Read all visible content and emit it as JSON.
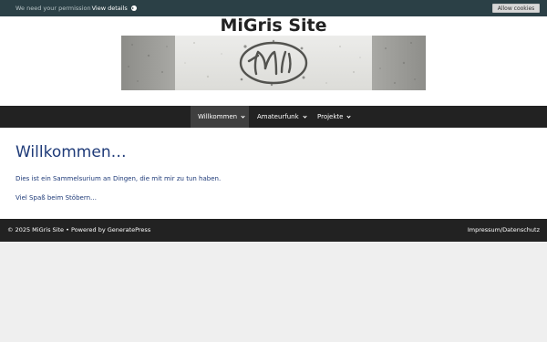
{
  "cookie_bar": {
    "message": "We need your permission",
    "link": "View details",
    "button": "Allow cookies"
  },
  "header": {
    "site_title": "MiGris Site"
  },
  "nav": {
    "items": [
      {
        "label": "Willkommen",
        "active": true
      },
      {
        "label": "Amateurfunk",
        "active": false
      },
      {
        "label": "Projekte",
        "active": false
      }
    ]
  },
  "main": {
    "title": "Willkommen…",
    "paragraphs": [
      "Dies ist ein Sammelsurium an Dingen, die mit mir zu tun haben.",
      "Viel Spaß beim Stöbern…"
    ]
  },
  "footer": {
    "copyright": "© 2025 MiGris Site • Powered by GeneratePress",
    "link": "Impressum/Datenschutz"
  },
  "colors": {
    "cookie_bar": "#2b4046",
    "nav_bg": "#222222",
    "nav_active": "#3f3f3f",
    "link_text": "#1e3a78",
    "page_bg": "#efefef"
  }
}
